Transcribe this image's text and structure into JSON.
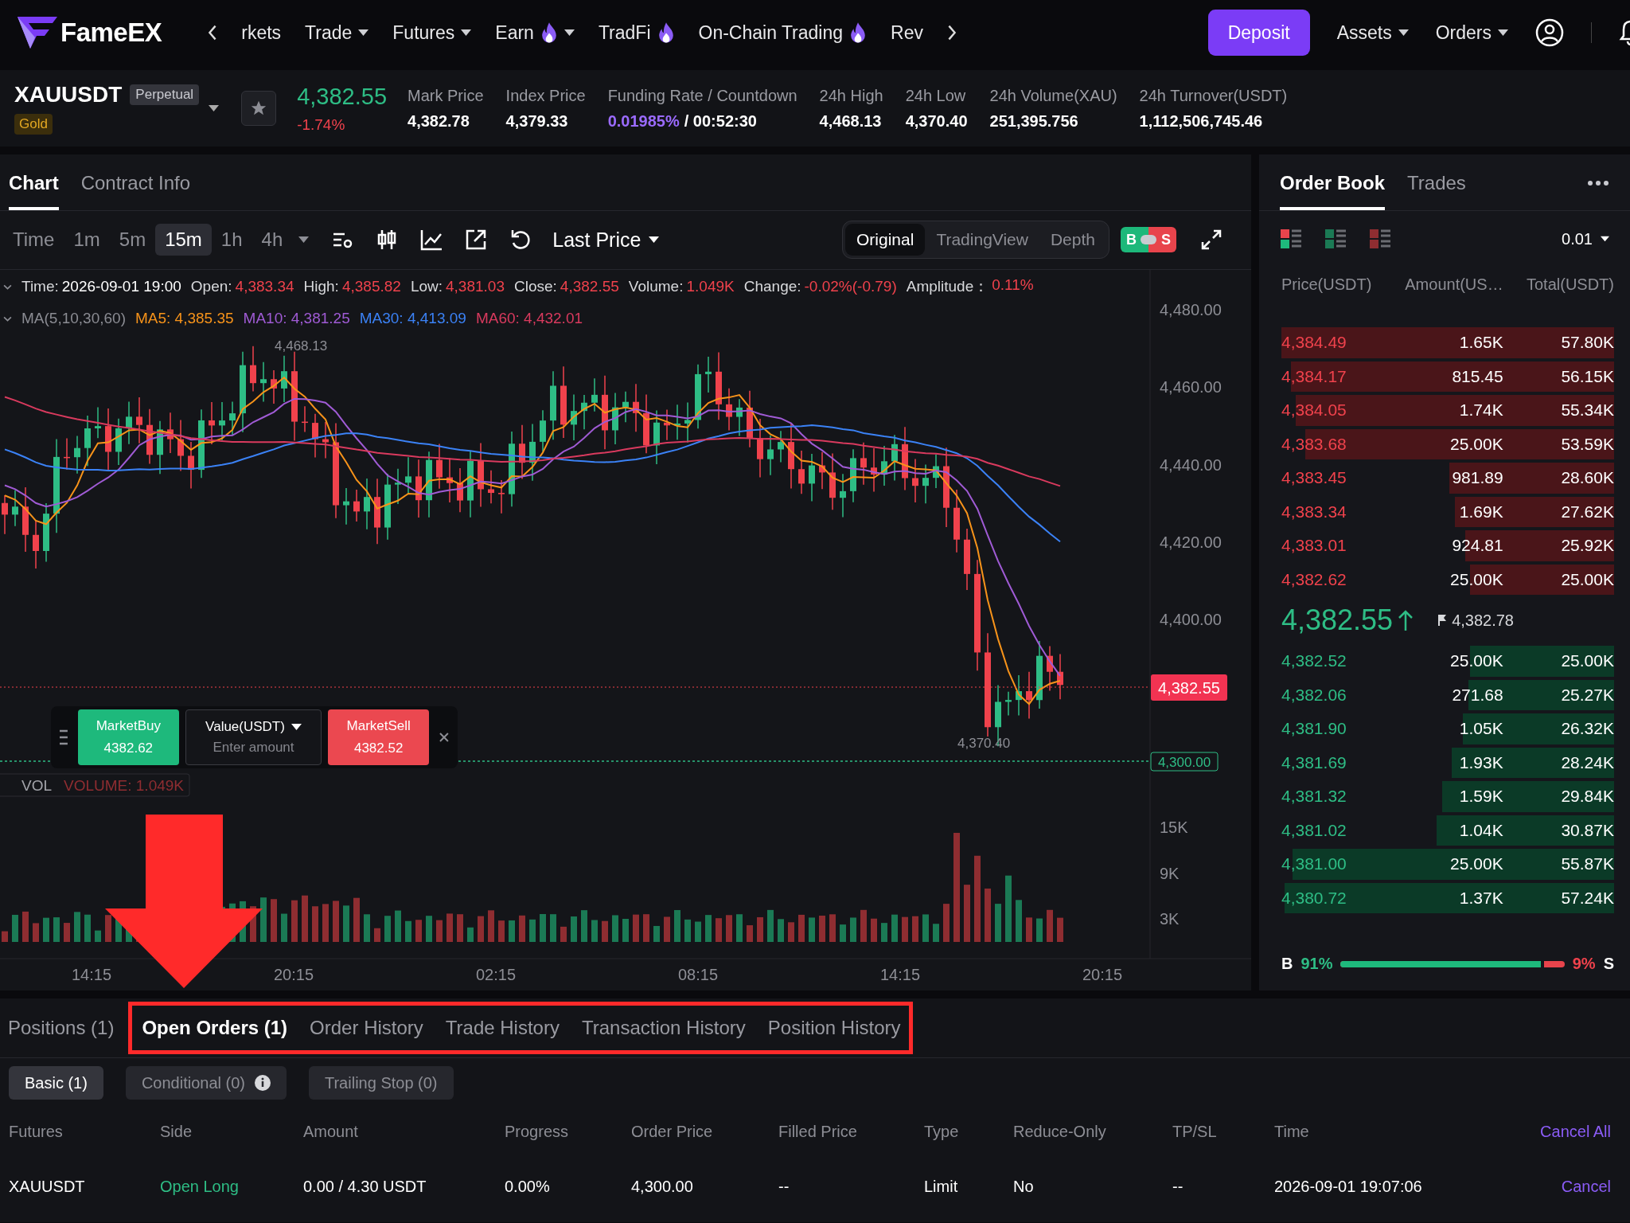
{
  "nav": {
    "logo": "FameEX",
    "items": [
      {
        "label": "rkets",
        "caret": false,
        "hot": false
      },
      {
        "label": "Trade",
        "caret": true,
        "hot": false
      },
      {
        "label": "Futures",
        "caret": true,
        "hot": false
      },
      {
        "label": "Earn",
        "caret": true,
        "hot": true
      },
      {
        "label": "TradFi",
        "caret": false,
        "hot": true
      },
      {
        "label": "On-Chain Trading",
        "caret": false,
        "hot": true
      },
      {
        "label": "Rev",
        "caret": false,
        "hot": false
      }
    ],
    "deposit": "Deposit",
    "menus": [
      "Assets",
      "Orders"
    ]
  },
  "ticker": {
    "symbol": "XAUUSDT",
    "badge": "Perpetual",
    "tag": "Gold",
    "price": "4,382.55",
    "change": "-1.74%",
    "stats": [
      {
        "label": "Mark Price",
        "value": "4,382.78"
      },
      {
        "label": "Index Price",
        "value": "4,379.33"
      },
      {
        "label": "Funding Rate / Countdown",
        "rate": "0.01985%",
        "value": "/ 00:52:30"
      },
      {
        "label": "24h High",
        "value": "4,468.13"
      },
      {
        "label": "24h Low",
        "value": "4,370.40"
      },
      {
        "label": "24h Volume(XAU)",
        "value": "251,395.756"
      },
      {
        "label": "24h Turnover(USDT)",
        "value": "1,112,506,745.46"
      }
    ]
  },
  "chart_panel": {
    "tabs": [
      {
        "label": "Chart",
        "selected": true
      },
      {
        "label": "Contract Info",
        "selected": false
      }
    ],
    "intervals": [
      {
        "label": "Time",
        "selected": false
      },
      {
        "label": "1m",
        "selected": false
      },
      {
        "label": "5m",
        "selected": false
      },
      {
        "label": "15m",
        "selected": true
      },
      {
        "label": "1h",
        "selected": false
      },
      {
        "label": "4h",
        "selected": false
      }
    ],
    "price_type": "Last Price",
    "views": [
      {
        "label": "Original",
        "selected": true
      },
      {
        "label": "TradingView",
        "selected": false
      },
      {
        "label": "Depth",
        "selected": false
      }
    ],
    "bs_toggle": {
      "buy": "B",
      "sell": "S"
    },
    "info": [
      {
        "label": "Time:",
        "value": "2026-09-01 19:00",
        "color": "#ffffff"
      },
      {
        "label": "Open:",
        "value": "4,383.34",
        "color": "#f0424c"
      },
      {
        "label": "High:",
        "value": "4,385.82",
        "color": "#f0424c"
      },
      {
        "label": "Low:",
        "value": "4,381.03",
        "color": "#f0424c"
      },
      {
        "label": "Close:",
        "value": "4,382.55",
        "color": "#f0424c"
      },
      {
        "label": "Volume:",
        "value": "1.049K",
        "color": "#f0424c"
      },
      {
        "label": "Change:",
        "value": "-0.02%(-0.79)",
        "color": "#f0424c"
      },
      {
        "label": "Amplitude：",
        "value": "0.11%",
        "color": "#f0424c"
      }
    ],
    "ma": {
      "label": "MA(5,10,30,60)",
      "lines": [
        {
          "text": "MA5: 4,385.35",
          "color": "#f7931a"
        },
        {
          "text": "MA10: 4,381.25",
          "color": "#a05bd5"
        },
        {
          "text": "MA30: 4,413.09",
          "color": "#3b82f6"
        },
        {
          "text": "MA60: 4,432.01",
          "color": "#d93a5e"
        }
      ]
    },
    "price_axis": [
      "4,480.00",
      "4,460.00",
      "4,440.00",
      "4,420.00",
      "4,400.00"
    ],
    "last_price_tag": "4,382.55",
    "order_line_tag": "4,300.00",
    "high_marker": "4,468.13",
    "low_marker": "4,370.40",
    "volume": {
      "label": "VOL",
      "reading": "VOLUME: 1.049K",
      "axis": [
        "15K",
        "9K",
        "3K"
      ]
    },
    "time_axis": [
      "14:15",
      "20:15",
      "02:15",
      "08:15",
      "14:15",
      "20:15"
    ],
    "quick_trade": {
      "buy_label": "MarketBuy",
      "buy_price": "4382.62",
      "unit": "Value(USDT)",
      "placeholder": "Enter amount",
      "sell_label": "MarketSell",
      "sell_price": "4382.52"
    }
  },
  "order_book": {
    "tabs": [
      {
        "label": "Order Book",
        "selected": true
      },
      {
        "label": "Trades",
        "selected": false
      }
    ],
    "precision": "0.01",
    "columns": [
      "Price(USDT)",
      "Amount(US…",
      "Total(USDT)"
    ],
    "asks": [
      {
        "price": "4,384.49",
        "amount": "1.65K",
        "total": "57.80K"
      },
      {
        "price": "4,384.17",
        "amount": "815.45",
        "total": "56.15K"
      },
      {
        "price": "4,384.05",
        "amount": "1.74K",
        "total": "55.34K"
      },
      {
        "price": "4,383.68",
        "amount": "25.00K",
        "total": "53.59K"
      },
      {
        "price": "4,383.45",
        "amount": "981.89",
        "total": "28.60K"
      },
      {
        "price": "4,383.34",
        "amount": "1.69K",
        "total": "27.62K"
      },
      {
        "price": "4,383.01",
        "amount": "924.81",
        "total": "25.92K"
      },
      {
        "price": "4,382.62",
        "amount": "25.00K",
        "total": "25.00K"
      }
    ],
    "last": "4,382.55",
    "mark": "4,382.78",
    "bids": [
      {
        "price": "4,382.52",
        "amount": "25.00K",
        "total": "25.00K"
      },
      {
        "price": "4,382.06",
        "amount": "271.68",
        "total": "25.27K"
      },
      {
        "price": "4,381.90",
        "amount": "1.05K",
        "total": "26.32K"
      },
      {
        "price": "4,381.69",
        "amount": "1.93K",
        "total": "28.24K"
      },
      {
        "price": "4,381.32",
        "amount": "1.59K",
        "total": "29.84K"
      },
      {
        "price": "4,381.02",
        "amount": "1.04K",
        "total": "30.87K"
      },
      {
        "price": "4,381.00",
        "amount": "25.00K",
        "total": "55.87K"
      },
      {
        "price": "4,380.72",
        "amount": "1.37K",
        "total": "57.24K"
      }
    ],
    "ratio": {
      "buy_label": "B",
      "buy": "91%",
      "sell": "9%",
      "sell_label": "S",
      "level": 0.91
    }
  },
  "orders_panel": {
    "tabs": [
      {
        "label": "Positions (1)",
        "selected": false,
        "highlighted": false
      },
      {
        "label": "Open Orders (1)",
        "selected": true,
        "highlighted": true
      },
      {
        "label": "Order History",
        "selected": false,
        "highlighted": true
      },
      {
        "label": "Trade History",
        "selected": false,
        "highlighted": true
      },
      {
        "label": "Transaction History",
        "selected": false,
        "highlighted": true
      },
      {
        "label": "Position History",
        "selected": false,
        "highlighted": true
      }
    ],
    "subtabs": [
      {
        "label": "Basic (1)",
        "selected": true,
        "info": false
      },
      {
        "label": "Conditional (0)",
        "selected": false,
        "info": true
      },
      {
        "label": "Trailing Stop (0)",
        "selected": false,
        "info": false
      }
    ],
    "columns": [
      "Futures",
      "Side",
      "Amount",
      "Progress",
      "Order Price",
      "Filled Price",
      "Type",
      "Reduce-Only",
      "TP/SL",
      "Time"
    ],
    "cancel_all": "Cancel All",
    "rows": [
      {
        "cells": [
          "XAUUSDT",
          "Open Long",
          "0.00 / 4.30 USDT",
          "0.00%",
          "4,300.00",
          "--",
          "Limit",
          "No",
          "--",
          "2026-09-01 19:07:06"
        ],
        "color": "#2ebd85",
        "action": "Cancel"
      }
    ]
  }
}
